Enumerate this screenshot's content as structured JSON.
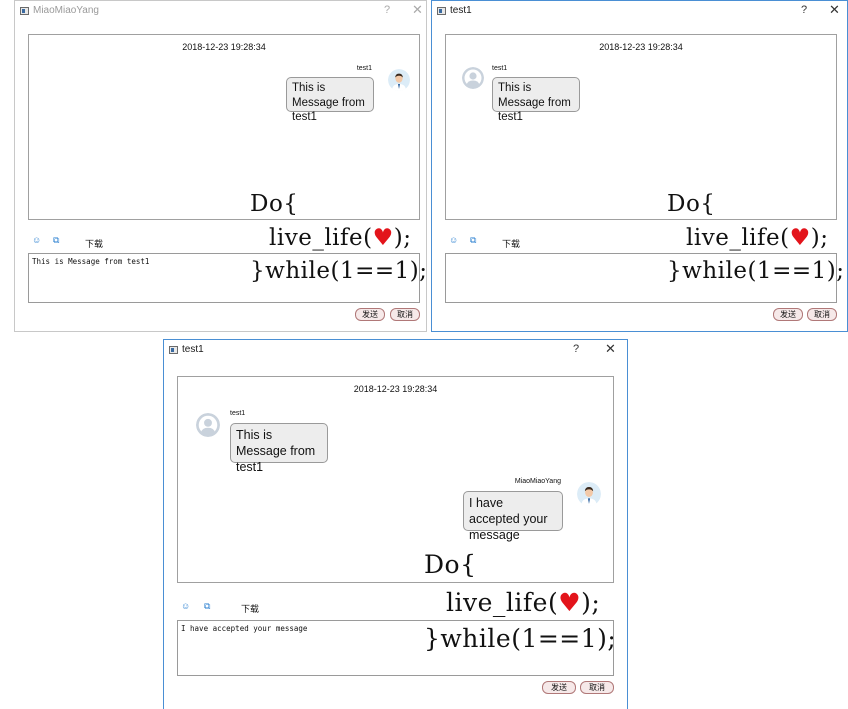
{
  "windows": [
    {
      "title": "MiaoMiaoYang",
      "help": "?",
      "close": "✕",
      "timestamp": "2018-12-23 19:28:34",
      "messages": [
        {
          "sender": "test1",
          "text": "This is Message from test1",
          "side": "right"
        }
      ],
      "download": "下载",
      "deco": {
        "line1": "Do{",
        "line2a": "live_life(",
        "heart": "♥",
        "line2b": ");",
        "line3": "}while(1==1);"
      },
      "input": "This is Message from test1",
      "send": "发送",
      "cancel": "取消"
    },
    {
      "title": "test1",
      "help": "?",
      "close": "✕",
      "timestamp": "2018-12-23 19:28:34",
      "messages": [
        {
          "sender": "test1",
          "text": "This is Message from test1",
          "side": "left"
        }
      ],
      "download": "下载",
      "deco": {
        "line1": "Do{",
        "line2a": "live_life(",
        "heart": "♥",
        "line2b": ");",
        "line3": "}while(1==1);"
      },
      "input": "",
      "send": "发送",
      "cancel": "取消"
    },
    {
      "title": "test1",
      "help": "?",
      "close": "✕",
      "timestamp": "2018-12-23 19:28:34",
      "messages": [
        {
          "sender": "test1",
          "text": "This is Message from test1",
          "side": "left"
        },
        {
          "sender": "MiaoMiaoYang",
          "text": "I have accepted your message",
          "side": "right"
        }
      ],
      "download": "下载",
      "deco": {
        "line1": "Do{",
        "line2a": "live_life(",
        "heart": "♥",
        "line2b": ");",
        "line3": "}while(1==1);"
      },
      "input": "I have accepted your message",
      "send": "发送",
      "cancel": "取消"
    }
  ],
  "icons": {
    "emoji": "emoji-face-icon",
    "screenshot": "screenshot-icon",
    "window": "window-icon",
    "avatar": "user-avatar-icon"
  },
  "colors": {
    "window_active_border": "#4a8fd4",
    "bubble_bg": "#ededed",
    "button_bg": "#f6e9e9",
    "heart": "#e3141b"
  }
}
